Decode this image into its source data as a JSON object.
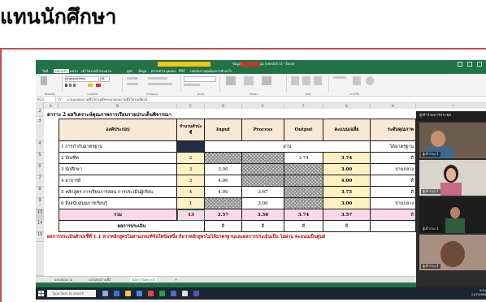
{
  "slide": {
    "title": "แทนนักศึกษา"
  },
  "window": {
    "title": "ข้อมูลเอกสารสนับสนุน (version 1) - Excel",
    "alert_text": "ซ่อนการแจ้งเตือน",
    "rec_text": "REC",
    "tabs": [
      "ไฟล์",
      "หน้าแรก",
      "แทรก",
      "เค้าโครงหน้ากระดาษ",
      "สูตร",
      "ข้อมูล",
      "ตรวจทาน",
      "มุมมอง",
      "PDF",
      "บอกฉันว่าคุณต้องการทำอะไร"
    ],
    "active_tab_index": 1,
    "ribbon_groups": [
      "คลิปบอร์ด",
      "แบบอักษร",
      "การจัดแนว",
      "ตัวเลข",
      "ลักษณะ",
      "เซลล์",
      "การแก้ไข"
    ],
    "font_name": "Angsana New",
    "font_size": "16",
    "name_box": "B13",
    "formula": "=(แบบสอบถามที่1!ค่าเฉลี่ย+แบบสอบถามที่2!ค่าเฉลี่ย)/2"
  },
  "columns": [
    "A",
    "B",
    "C",
    "D",
    "E",
    "F",
    "G",
    "H",
    "I"
  ],
  "sheet": {
    "caption": "ตาราง 2 ผลวิเคราะห์คุณภาพการเรียนรายประเด็นพิจารณา",
    "headers": {
      "component": "องค์ประกอบ",
      "indicators": "จำนวนตัวบ่งชี้",
      "input": "Input",
      "process": "Process",
      "output": "Output",
      "average": "คะแนนเฉลี่ย",
      "level": "ระดับคุณภาพ"
    },
    "pass_label": "ผ่าน",
    "pass_level": "ได้มาตรฐาน",
    "rows": [
      {
        "n": "4",
        "name": "1 การกำกับมาตรฐาน",
        "ind": "",
        "input": "",
        "process": "",
        "output": "",
        "avg": "",
        "level": ""
      },
      {
        "n": "5",
        "name": "2 บัณฑิต",
        "ind": "2",
        "input": "",
        "process": "",
        "output": "3.74",
        "avg": "3.74",
        "level": "ดี"
      },
      {
        "n": "6",
        "name": "3 นักศึกษา",
        "ind": "3",
        "input": "3.00",
        "process": "",
        "output": "",
        "avg": "3.00",
        "level": "ปานกลาง"
      },
      {
        "n": "7",
        "name": "4 อาจารย์",
        "ind": "3",
        "input": "4.00",
        "process": "",
        "output": "",
        "avg": "4.00",
        "level": "ดี"
      },
      {
        "n": "8",
        "name": "5 หลักสูตร การเรียนการสอน การประเมินผู้เรียน",
        "ind": "4",
        "input": "4.00",
        "process": "3.67",
        "output": "",
        "avg": "3.75",
        "level": "ดี"
      },
      {
        "n": "9",
        "name": "6 สิ่งสนับสนุนการเรียนรู้",
        "ind": "1",
        "input": "",
        "process": "3.00",
        "output": "",
        "avg": "3.00",
        "level": "ปานกลาง"
      }
    ],
    "total": {
      "n": "13",
      "label": "รวม",
      "ind": "13",
      "input": "3.57",
      "process": "3.50",
      "output": "3.74",
      "avg": "3.57",
      "level": "ดี"
    },
    "result": {
      "n": "14",
      "label": "ผลการประเมิน",
      "input": "ดี",
      "process": "ดี",
      "output": "ดี",
      "avg": "ดี"
    },
    "note": {
      "n": "15",
      "text": "ผลการประเมินตัวบ่งชี้ที่ 1.1 หากหลักสูตรไม่ผ่านเกณฑ์ข้อใดข้อหนึ่ง ถือว่าหลักสูตรไม่ได้มาตรฐานและผลการประเมินเป็น ไม่ผ่าน คะแนนเป็นศูนย์"
    }
  },
  "sheet_tabs": [
    "แบบสอบถาม",
    "แบบสอบถามที่2",
    "ผลการวิเคราะห์"
  ],
  "active_sheet_index": 2,
  "taskbar": {
    "search_placeholder": "Type here to search",
    "time": "9:24",
    "date": "21/7/2564"
  },
  "meeting": {
    "header": "ผู้เข้าร่วมการประชุม",
    "participants": [
      {
        "name": "ผู้เข้าร่วม 1"
      },
      {
        "name": "ผู้เข้าร่วม 2"
      },
      {
        "name": "ผู้เข้าร่วม 3"
      },
      {
        "name": "ผู้เข้าร่วม 4"
      }
    ]
  },
  "colors": {
    "excel_green": "#217346",
    "frame": "#c0504d",
    "header_fill": "#f9e8d6",
    "average_fill": "#fdf1c3",
    "note_red": "#c00000"
  }
}
